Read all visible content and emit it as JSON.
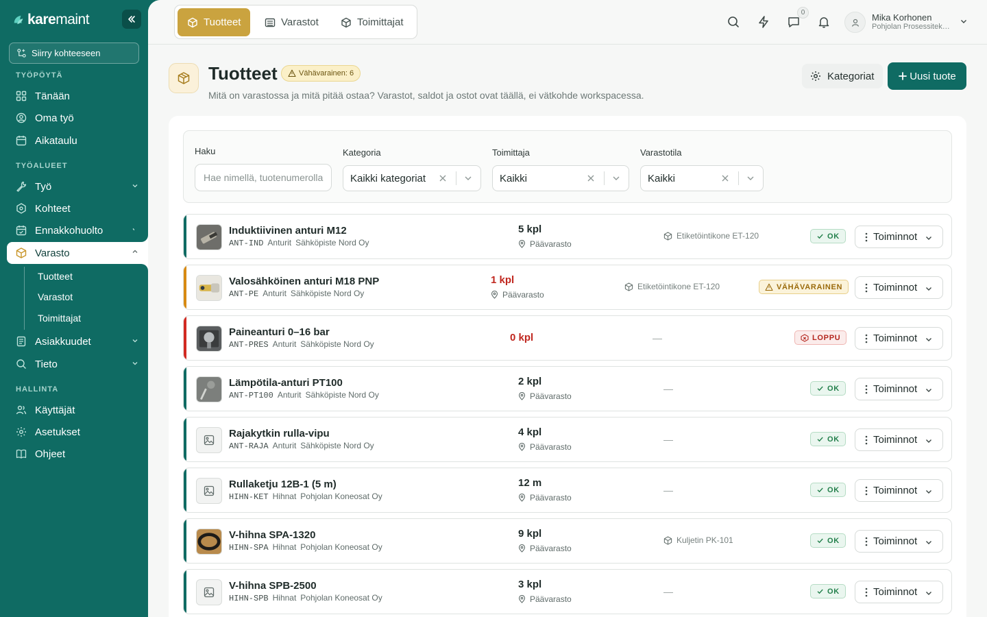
{
  "app": {
    "logo_bold": "kare",
    "logo_light": "maint"
  },
  "sidebar": {
    "goto_label": "Siirry kohteeseen",
    "sections": {
      "desk": "TYÖPÖYTÄ",
      "areas": "TYÖALUEET",
      "admin": "HALLINTA"
    },
    "items": {
      "today": "Tänään",
      "mywork": "Oma työ",
      "schedule": "Aikataulu",
      "work": "Työ",
      "sites": "Kohteet",
      "preventive": "Ennakkohuolto",
      "stock": "Varasto",
      "customers": "Asiakkuudet",
      "info": "Tieto",
      "users": "Käyttäjät",
      "settings": "Asetukset",
      "help": "Ohjeet"
    },
    "stock_sub": [
      "Tuotteet",
      "Varastot",
      "Toimittajat"
    ]
  },
  "topbar": {
    "tabs": [
      "Tuotteet",
      "Varastot",
      "Toimittajat"
    ],
    "notif_count": "0",
    "user_name": "Mika Korhonen",
    "user_org": "Pohjolan Prosessitekniikka Oy"
  },
  "page": {
    "title": "Tuotteet",
    "low_badge": "Vähävarainen: 6",
    "subtitle": "Mitä on varastossa ja mitä pitää ostaa? Varastot, saldot ja ostot ovat täällä, ei vätkohde workspacessa.",
    "categories_btn": "Kategoriat",
    "new_btn": "Uusi tuote"
  },
  "filters": {
    "search_label": "Haku",
    "search_placeholder": "Hae nimellä, tuotenumerolla",
    "category_label": "Kategoria",
    "category_value": "Kaikki kategoriat",
    "supplier_label": "Toimittaja",
    "supplier_value": "Kaikki",
    "stock_label": "Varastotila",
    "stock_value": "Kaikki"
  },
  "actions_label": "Toiminnot",
  "products": [
    {
      "name": "Induktiivinen anturi M12",
      "code": "ANT-IND",
      "category": "Anturit",
      "supplier": "Sähköpiste Nord Oy",
      "qty": "5 kpl",
      "location": "Päävarasto",
      "tag": "Etiketöintikone ET-120",
      "status": "OK",
      "status_type": "ok",
      "accent": "#0f6b63",
      "thumb": "sensor-dark"
    },
    {
      "name": "Valosähköinen anturi M18 PNP",
      "code": "ANT-PE",
      "category": "Anturit",
      "supplier": "Sähköpiste Nord Oy",
      "qty": "1 kpl",
      "location": "Päävarasto",
      "tag": "Etiketöintikone ET-120",
      "status": "VÄHÄVARAINEN",
      "status_type": "low",
      "accent": "#d88a12",
      "thumb": "sensor-light"
    },
    {
      "name": "Paineanturi 0–16 bar",
      "code": "ANT-PRES",
      "category": "Anturit",
      "supplier": "Sähköpiste Nord Oy",
      "qty": "0 kpl",
      "location": "",
      "tag": "—",
      "status": "LOPPU",
      "status_type": "out",
      "accent": "#d22a22",
      "thumb": "pressure"
    },
    {
      "name": "Lämpötila-anturi PT100",
      "code": "ANT-PT100",
      "category": "Anturit",
      "supplier": "Sähköpiste Nord Oy",
      "qty": "2 kpl",
      "location": "Päävarasto",
      "tag": "—",
      "status": "OK",
      "status_type": "ok",
      "accent": "#0f6b63",
      "thumb": "temp"
    },
    {
      "name": "Rajakytkin rulla-vipu",
      "code": "ANT-RAJA",
      "category": "Anturit",
      "supplier": "Sähköpiste Nord Oy",
      "qty": "4 kpl",
      "location": "Päävarasto",
      "tag": "—",
      "status": "OK",
      "status_type": "ok",
      "accent": "#0f6b63",
      "thumb": "placeholder"
    },
    {
      "name": "Rullaketju 12B-1 (5 m)",
      "code": "HIHN-KET",
      "category": "Hihnat",
      "supplier": "Pohjolan Koneosat Oy",
      "qty": "12 m",
      "location": "Päävarasto",
      "tag": "—",
      "status": "OK",
      "status_type": "ok",
      "accent": "#0f6b63",
      "thumb": "placeholder"
    },
    {
      "name": "V-hihna SPA-1320",
      "code": "HIHN-SPA",
      "category": "Hihnat",
      "supplier": "Pohjolan Koneosat Oy",
      "qty": "9 kpl",
      "location": "Päävarasto",
      "tag": "Kuljetin PK-101",
      "status": "OK",
      "status_type": "ok",
      "accent": "#0f6b63",
      "thumb": "belt"
    },
    {
      "name": "V-hihna SPB-2500",
      "code": "HIHN-SPB",
      "category": "Hihnat",
      "supplier": "Pohjolan Koneosat Oy",
      "qty": "3 kpl",
      "location": "Päävarasto",
      "tag": "—",
      "status": "OK",
      "status_type": "ok",
      "accent": "#0f6b63",
      "thumb": "placeholder"
    }
  ]
}
